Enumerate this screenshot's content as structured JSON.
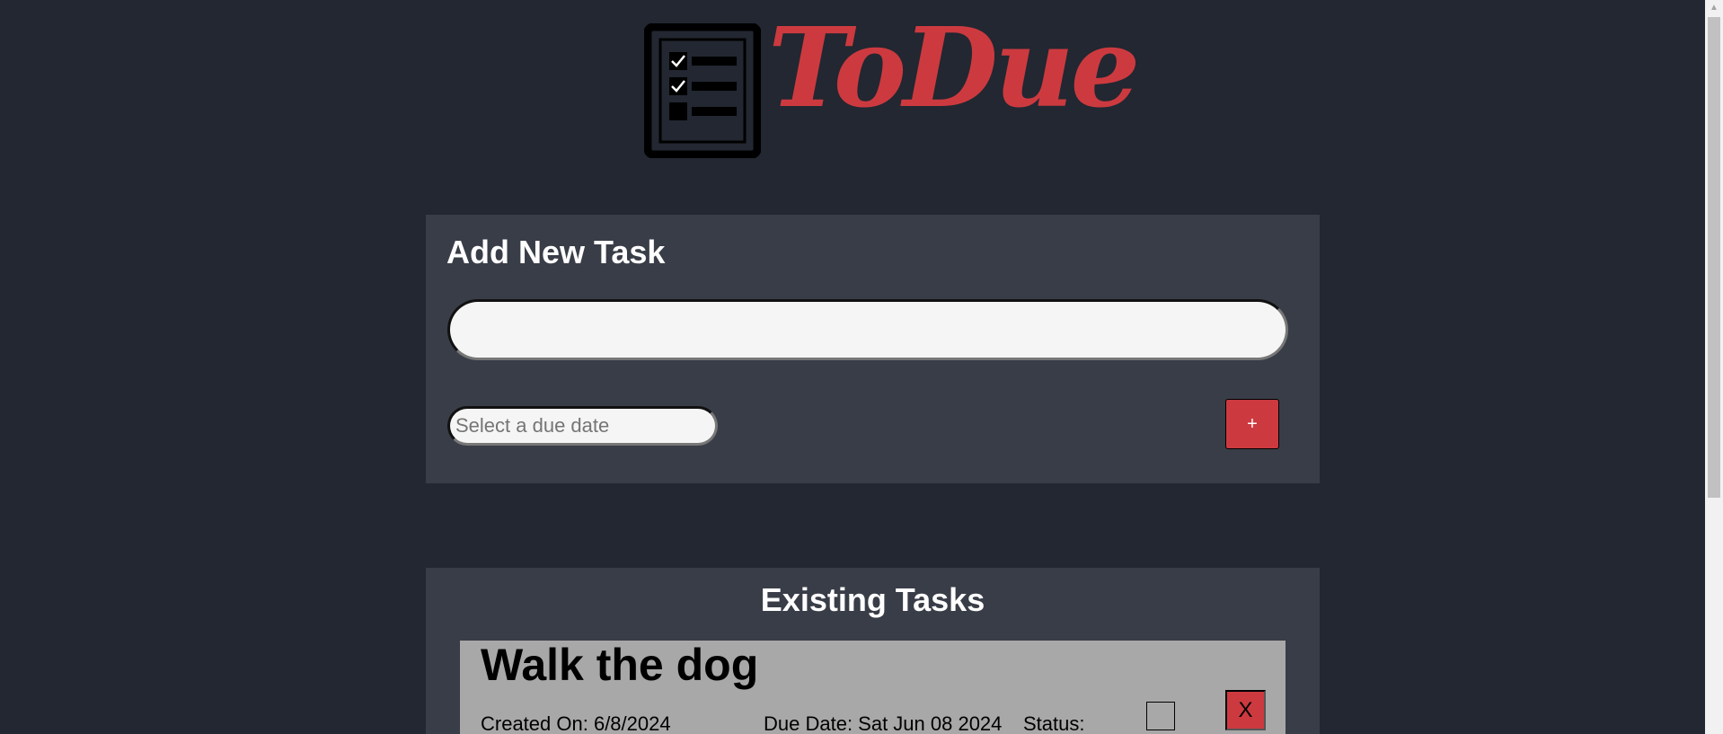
{
  "logo": {
    "text": "ToDue",
    "icon": "checklist-icon",
    "color": "#cc3a3f"
  },
  "add_task": {
    "title": "Add New Task",
    "task_input_value": "",
    "date_placeholder": "Select a due date",
    "add_button_label": "+"
  },
  "existing_tasks": {
    "title": "Existing Tasks",
    "items": [
      {
        "title": "Walk the dog",
        "created": "Created On: 6/8/2024",
        "due": "Due Date: Sat Jun 08 2024",
        "status_label": "Status:",
        "status_checked": false,
        "delete_label": "X"
      }
    ]
  },
  "colors": {
    "background": "#222731",
    "panel": "#393d47",
    "accent": "#cc3a3f",
    "task_card": "#a8a8a8"
  }
}
